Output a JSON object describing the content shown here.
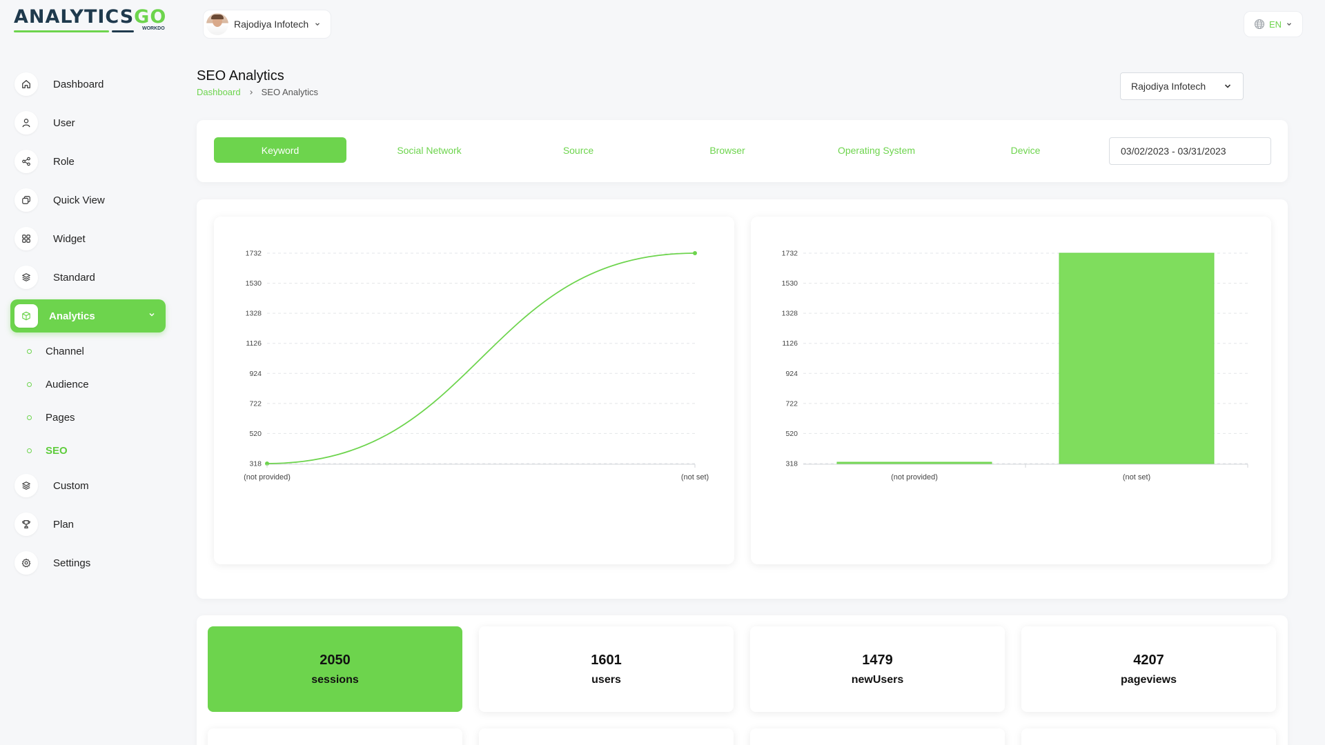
{
  "brand": {
    "logo_main": "ANALYTICS",
    "logo_accent": "GO",
    "logo_sub": "WORKDO"
  },
  "topbar": {
    "user_name": "Rajodiya Infotech",
    "language": "EN"
  },
  "sidebar": {
    "items": [
      {
        "label": "Dashboard",
        "icon": "home-icon"
      },
      {
        "label": "User",
        "icon": "user-icon"
      },
      {
        "label": "Role",
        "icon": "share-icon"
      },
      {
        "label": "Quick View",
        "icon": "copy-icon"
      },
      {
        "label": "Widget",
        "icon": "grid-icon"
      },
      {
        "label": "Standard",
        "icon": "layers-icon"
      },
      {
        "label": "Analytics",
        "icon": "box-icon"
      },
      {
        "label": "Custom",
        "icon": "layers-icon"
      },
      {
        "label": "Plan",
        "icon": "trophy-icon"
      },
      {
        "label": "Settings",
        "icon": "gear-icon"
      }
    ],
    "analytics_sub": [
      "Channel",
      "Audience",
      "Pages",
      "SEO"
    ],
    "active_item": "Analytics",
    "active_sub": "SEO"
  },
  "page": {
    "title": "SEO Analytics",
    "breadcrumb": {
      "home": "Dashboard",
      "current": "SEO Analytics"
    },
    "org_select": "Rajodiya Infotech"
  },
  "tabs": {
    "items": [
      "Keyword",
      "Social Network",
      "Source",
      "Browser",
      "Operating System",
      "Device"
    ],
    "active": "Keyword",
    "date_range": "03/02/2023 - 03/31/2023"
  },
  "colors": {
    "accent": "#6dd44d",
    "background": "#f6f7f9",
    "text": "#222222"
  },
  "chart_data": [
    {
      "type": "line",
      "categories": [
        "(not provided)",
        "(not set)"
      ],
      "series": [
        {
          "values": [
            318,
            1732
          ]
        }
      ],
      "yticks": [
        318,
        520,
        722,
        924,
        1126,
        1328,
        1530,
        1732
      ],
      "ylim": [
        318,
        1732
      ],
      "grid": true,
      "smooth": true
    },
    {
      "type": "bar",
      "categories": [
        "(not provided)",
        "(not set)"
      ],
      "series": [
        {
          "values": [
            318,
            1732
          ]
        }
      ],
      "yticks": [
        318,
        520,
        722,
        924,
        1126,
        1328,
        1530,
        1732
      ],
      "ylim": [
        318,
        1732
      ],
      "grid": true
    }
  ],
  "stats": [
    {
      "value": "2050",
      "label": "sessions"
    },
    {
      "value": "1601",
      "label": "users"
    },
    {
      "value": "1479",
      "label": "newUsers"
    },
    {
      "value": "4207",
      "label": "pageviews"
    }
  ]
}
